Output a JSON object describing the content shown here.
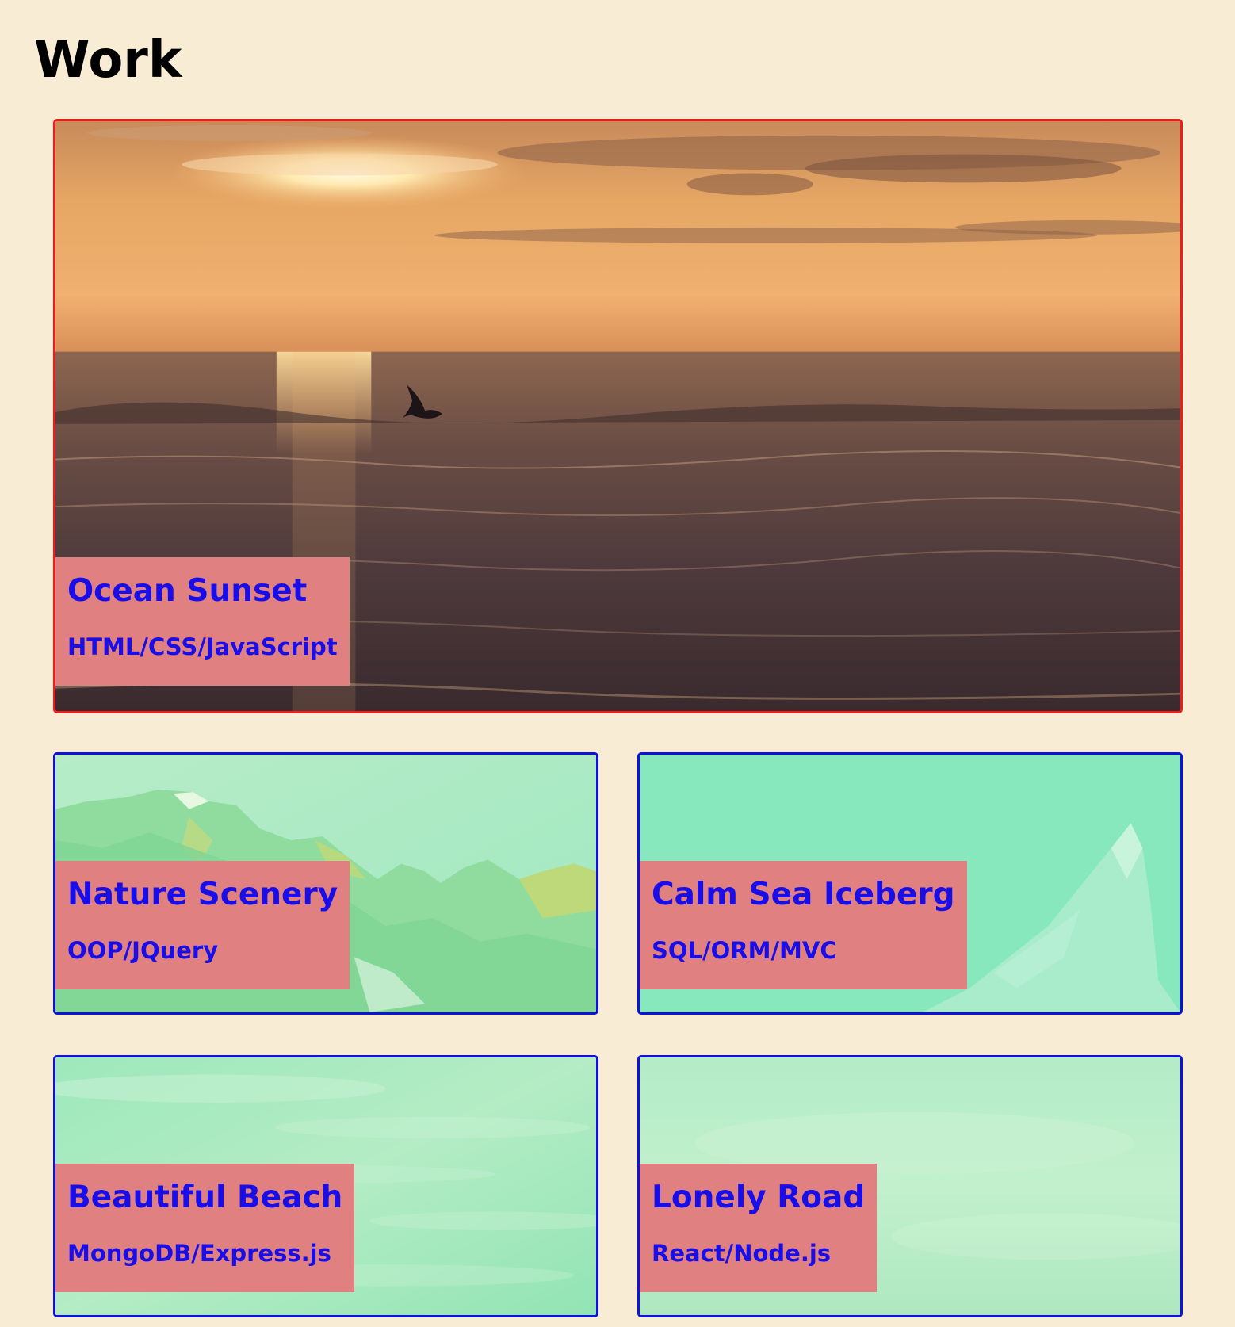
{
  "page": {
    "title": "Work"
  },
  "projects": [
    {
      "title": "Ocean Sunset",
      "tech": "HTML/CSS/JavaScript",
      "image": "ocean-sunset-photo",
      "border_color": "#ee1c1c"
    },
    {
      "title": "Nature Scenery",
      "tech": "OOP/JQuery",
      "image": "mountain-range-photo",
      "border_color": "#1010e0"
    },
    {
      "title": "Calm Sea Iceberg",
      "tech": "SQL/ORM/MVC",
      "image": "iceberg-photo",
      "border_color": "#1010e0"
    },
    {
      "title": "Beautiful Beach",
      "tech": "MongoDB/Express.js",
      "image": "beach-sky-photo",
      "border_color": "#1010e0"
    },
    {
      "title": "Lonely Road",
      "tech": "React/Node.js",
      "image": "road-sky-photo",
      "border_color": "#1010e0"
    }
  ],
  "colors": {
    "background": "#f8ecd4",
    "label_background": "#e08080",
    "label_text": "#1a0ee8",
    "overlay_tint": "#8fe6b8"
  }
}
